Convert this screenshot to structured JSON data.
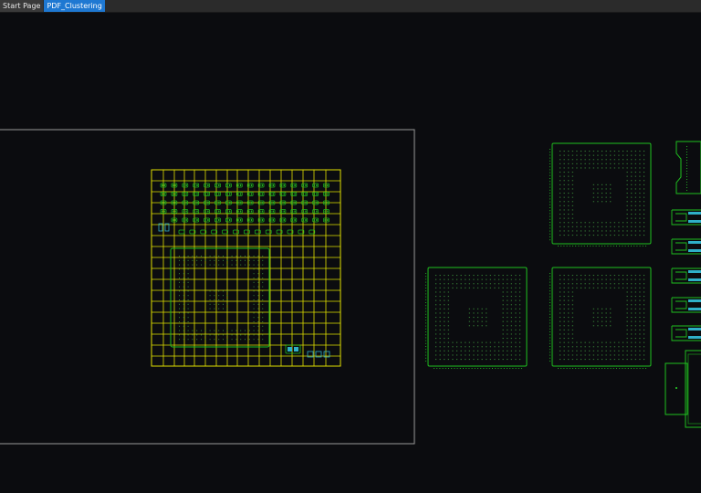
{
  "tabs": [
    {
      "label": "Start Page",
      "active": false
    },
    {
      "label": "PDF_Clustering",
      "active": true
    }
  ],
  "colors": {
    "background": "#0b0c0f",
    "board_outline": "#9a9a9a",
    "placement_grid": "#e0e000",
    "component_outline": "#1fbf1f",
    "pad": "#22aa22",
    "pad_highlight": "#2fb0c8",
    "tab_active": "#1e78d2"
  }
}
